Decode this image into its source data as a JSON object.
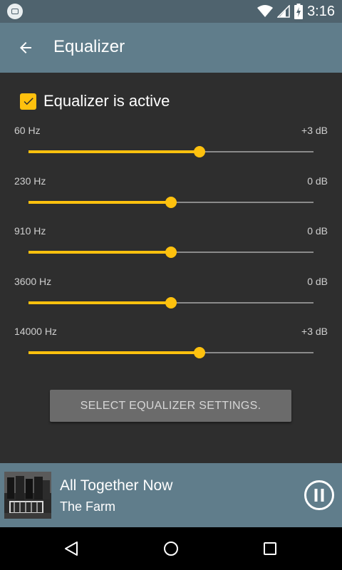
{
  "status_bar": {
    "time": "3:16"
  },
  "app_bar": {
    "title": "Equalizer"
  },
  "equalizer": {
    "active_label": "Equalizer is active",
    "active_checked": true,
    "bands": [
      {
        "frequency": "60 Hz",
        "gain": "+3 dB",
        "level": 0.6
      },
      {
        "frequency": "230 Hz",
        "gain": "0 dB",
        "level": 0.5
      },
      {
        "frequency": "910 Hz",
        "gain": "0 dB",
        "level": 0.5
      },
      {
        "frequency": "3600 Hz",
        "gain": "0 dB",
        "level": 0.5
      },
      {
        "frequency": "14000 Hz",
        "gain": "+3 dB",
        "level": 0.6
      }
    ],
    "select_settings_label": "SELECT EQUALIZER SETTINGS."
  },
  "now_playing": {
    "title": "All Together Now",
    "artist": "The Farm"
  },
  "colors": {
    "accent": "#fec10e",
    "toolbar": "#607d8b",
    "statusbar": "#4f636e",
    "background": "#2e2e2e"
  }
}
